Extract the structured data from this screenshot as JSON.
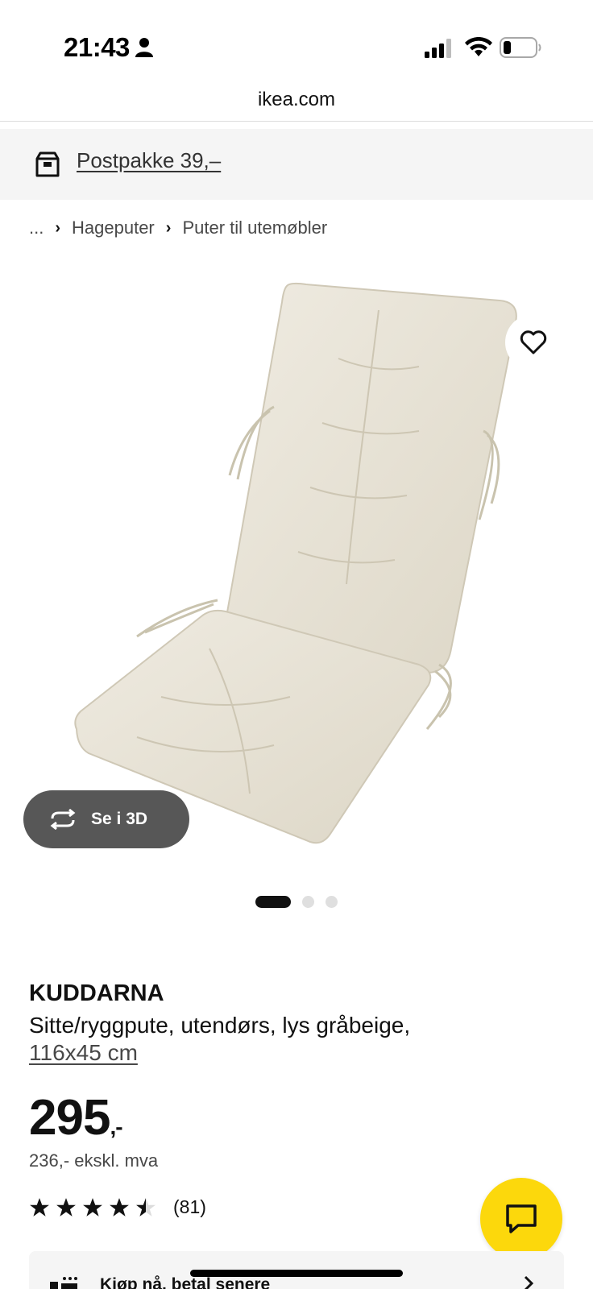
{
  "status_bar": {
    "time": "21:43",
    "icons": [
      "person-icon",
      "signal-icon",
      "wifi-icon",
      "battery-icon"
    ]
  },
  "browser": {
    "url": "ikea.com"
  },
  "promo": {
    "label": "Postpakke 39,–",
    "icon": "package-icon"
  },
  "breadcrumb": {
    "items": [
      "...",
      "Hageputer",
      "Puter til utemøbler"
    ]
  },
  "gallery": {
    "see_3d_label": "Se i 3D",
    "dots": 3,
    "active_dot": 0
  },
  "product": {
    "name": "KUDDARNA",
    "description": "Sitte/ryggpute, utendørs, lys gråbeige,",
    "size": "116x45 cm",
    "price": "295",
    "price_suffix": ",-",
    "price_ex_vat": "236,- ekskl. mva",
    "rating": 4.5,
    "rating_count": "(81)"
  },
  "klarna": {
    "label": "Kjøp nå, betal senere"
  },
  "colors": {
    "promo_bg": "#f5f5f5",
    "chat_yellow": "#fcd80c",
    "see3d_bg": "#575757",
    "cushion": "#e7e2d5"
  }
}
